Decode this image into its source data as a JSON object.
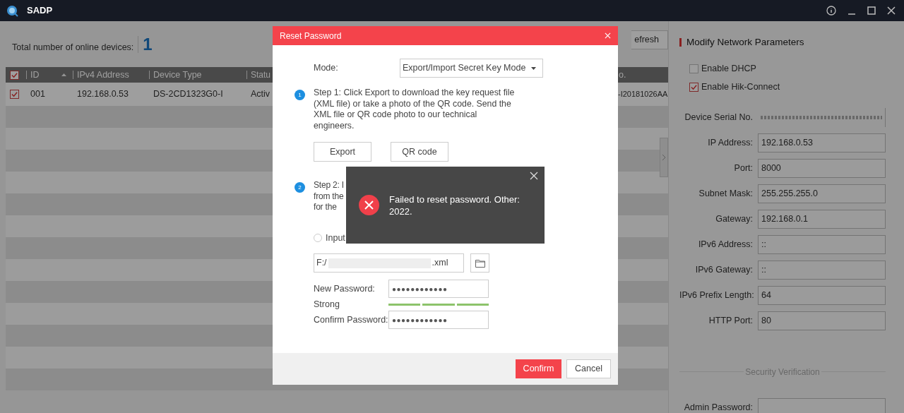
{
  "app": {
    "title": "SADP"
  },
  "summary": {
    "label": "Total number of online devices:",
    "count": "1"
  },
  "toolbar": {
    "refresh": "efresh"
  },
  "table": {
    "all_checked": true,
    "columns": [
      {
        "label": "ID",
        "sorted": true
      },
      {
        "label": "IPv4 Address",
        "sorted": false
      },
      {
        "label": "Device Type",
        "sorted": false
      },
      {
        "label": "Statu",
        "sorted": false
      },
      {
        "label": "o.",
        "sorted": false
      }
    ],
    "rows": [
      {
        "checked": true,
        "cells": [
          "001",
          "192.168.0.53",
          "DS-2CD1323G0-I",
          "Activ",
          "-I20181026AA"
        ]
      }
    ]
  },
  "side_panel": {
    "title": "Modify Network Parameters",
    "options": [
      {
        "label": "Enable DHCP",
        "checked": false
      },
      {
        "label": "Enable Hik-Connect",
        "checked": true
      }
    ],
    "fields": [
      {
        "kind": "redacted",
        "label": "Device Serial No."
      },
      {
        "kind": "text",
        "label": "IP Address:",
        "value": "192.168.0.53"
      },
      {
        "kind": "text",
        "label": "Port:",
        "value": "8000"
      },
      {
        "kind": "text",
        "label": "Subnet Mask:",
        "value": "255.255.255.0"
      },
      {
        "kind": "text",
        "label": "Gateway:",
        "value": "192.168.0.1"
      },
      {
        "kind": "text",
        "label": "IPv6 Address:",
        "value": "::"
      },
      {
        "kind": "text",
        "label": "IPv6 Gateway:",
        "value": "::"
      },
      {
        "kind": "text",
        "label": "IPv6 Prefix Length:",
        "value": "64"
      },
      {
        "kind": "text",
        "label": "HTTP Port:",
        "value": "80"
      }
    ],
    "section": "Security Verification",
    "admin_password": {
      "label": "Admin Password:"
    }
  },
  "dialog": {
    "title": "Reset Password",
    "mode_label": "Mode:",
    "mode_value": "Export/Import Secret Key Mode",
    "steps": [
      {
        "number": "1",
        "text": "Step 1: Click Export to download the key request file (XML file) or take a photo of the QR code. Send the XML file or QR code photo to our technical engineers."
      },
      {
        "number": "2",
        "lines": [
          "Step 2: I",
          "from the",
          "for the"
        ]
      }
    ],
    "step1_buttons": [
      "Export",
      "QR code"
    ],
    "radios": [
      {
        "label": "Input",
        "selected": false
      }
    ],
    "file": {
      "prefix": "F:/",
      "suffix": ".xml"
    },
    "new_password": {
      "label": "New Password:",
      "value": "●●●●●●●●●●●●"
    },
    "strength": {
      "label": "Strong",
      "level": 1
    },
    "confirm_password": {
      "label": "Confirm Password:",
      "value": "●●●●●●●●●●●●"
    },
    "confirm": "Confirm",
    "cancel": "Cancel"
  },
  "toast": {
    "message": "Failed to reset password. Other: 2022."
  }
}
